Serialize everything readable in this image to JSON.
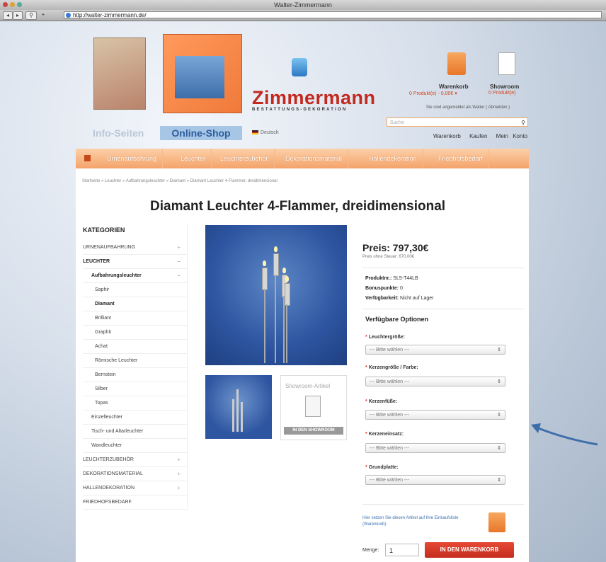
{
  "browser": {
    "window_title": "Walter-Zimmermann",
    "url": "http://walter-zimmermann.de/",
    "nav_buttons": [
      "◂",
      "▸"
    ]
  },
  "header": {
    "brand": "Zimmermann",
    "brand_sub": "BESTATTUNGS-DEKORATION",
    "tab_info": "Info-Seiten",
    "tab_shop": "Online-Shop",
    "language": "Deutsch",
    "cart_label": "Warenkorb",
    "cart_status": "0 Produkt(e) - 0,00€ ▾",
    "showroom_label": "Showroom",
    "showroom_status": "0 Produkt(e)",
    "logged_in": "Sie sind angemeldet als Walter ( Abmelden )",
    "search_placeholder": "Suche",
    "links": [
      "Warenkorb",
      "Kaufen",
      "Mein Konto"
    ]
  },
  "nav": {
    "items": [
      "Urnenaufbahrung",
      "Leuchter",
      "Leuchterzubehör",
      "Dekorationsmaterial",
      "Hallendekoration",
      "Friedhofsbedarf"
    ]
  },
  "breadcrumb": "Startseite  »  Leuchter  »  Aufbahrungsleuchter  »  Diamant  »  Diamant Leuchter 4-Flammer, dreidimensional",
  "product": {
    "title": "Diamant Leuchter 4-Flammer, dreidimensional",
    "price": "Preis: 797,30€",
    "price_net": "Preis ohne Steuer: 670,00€",
    "sku_label": "Produktnr.:",
    "sku": "SL5-T44LB",
    "bonus_label": "Bonuspunkte:",
    "bonus": "0",
    "avail_label": "Verfügbarkeit:",
    "avail": "Nicht auf Lager",
    "options_title": "Verfügbare Optionen",
    "options": [
      {
        "label": "Leuchtergröße:",
        "value": "--- Bitte wählen ---"
      },
      {
        "label": "Kerzengröße / Farbe:",
        "value": "--- Bitte wählen ---"
      },
      {
        "label": "Kerzenfüße:",
        "value": "--- Bitte wählen ---"
      },
      {
        "label": "Kerzeneinsatz:",
        "value": "--- Bitte wählen ---"
      },
      {
        "label": "Grundplatte:",
        "value": "--- Bitte wählen ---"
      }
    ],
    "add_note": "Hier setzen Sie diesen Artikel auf Ihre Einkaufsliste (Warenkorb):",
    "qty_label": "Menge:",
    "qty": "1",
    "add_button": "IN DEN WARENKORB",
    "showroom_title": "Showroom-Artikel",
    "showroom_button": "IN DEN SHOWROOM"
  },
  "sidebar": {
    "title": "KATEGORIEN",
    "items": [
      {
        "label": "URNENAUFBAHRUNG",
        "level": 0,
        "pm": "+"
      },
      {
        "label": "LEUCHTER",
        "level": 0,
        "pm": "–",
        "bold": true
      },
      {
        "label": "Aufbahrungsleuchter",
        "level": 1,
        "pm": "–",
        "bold": true
      },
      {
        "label": "Saphir",
        "level": 2
      },
      {
        "label": "Diamant",
        "level": 2,
        "bold": true
      },
      {
        "label": "Brilliant",
        "level": 2
      },
      {
        "label": "Graphit",
        "level": 2
      },
      {
        "label": "Achat",
        "level": 2
      },
      {
        "label": "Römische Leuchter",
        "level": 2
      },
      {
        "label": "Bernstein",
        "level": 2
      },
      {
        "label": "Silber",
        "level": 2
      },
      {
        "label": "Topas",
        "level": 2
      },
      {
        "label": "Einzelleuchter",
        "level": 1
      },
      {
        "label": "Tisch- und Altarleuchter",
        "level": 1
      },
      {
        "label": "Wandleuchter",
        "level": 1
      },
      {
        "label": "LEUCHTERZUBEHÖR",
        "level": 0,
        "pm": "+"
      },
      {
        "label": "DEKORATIONSMATERIAL",
        "level": 0,
        "pm": "+"
      },
      {
        "label": "HALLENDEKORATION",
        "level": 0,
        "pm": "+"
      },
      {
        "label": "FRIEDHOFSBEDARF",
        "level": 0
      }
    ]
  }
}
